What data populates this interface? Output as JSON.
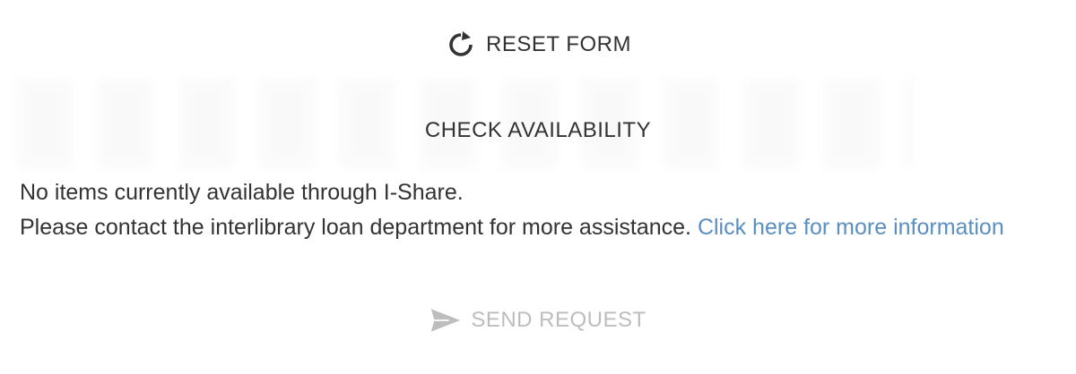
{
  "reset_form": {
    "label": "RESET FORM",
    "icon": "reset-icon"
  },
  "check_availability": {
    "label": "CHECK AVAILABILITY"
  },
  "message": {
    "line1": "No items currently available through I-Share.",
    "line2": "Please contact the interlibrary loan department for more assistance.",
    "link_text": "Click here for more information"
  },
  "send_request": {
    "label": "SEND REQUEST",
    "icon": "send-icon",
    "disabled": true
  },
  "colors": {
    "text": "#333333",
    "link": "#5a8fc0",
    "disabled": "#bdbdbd"
  }
}
